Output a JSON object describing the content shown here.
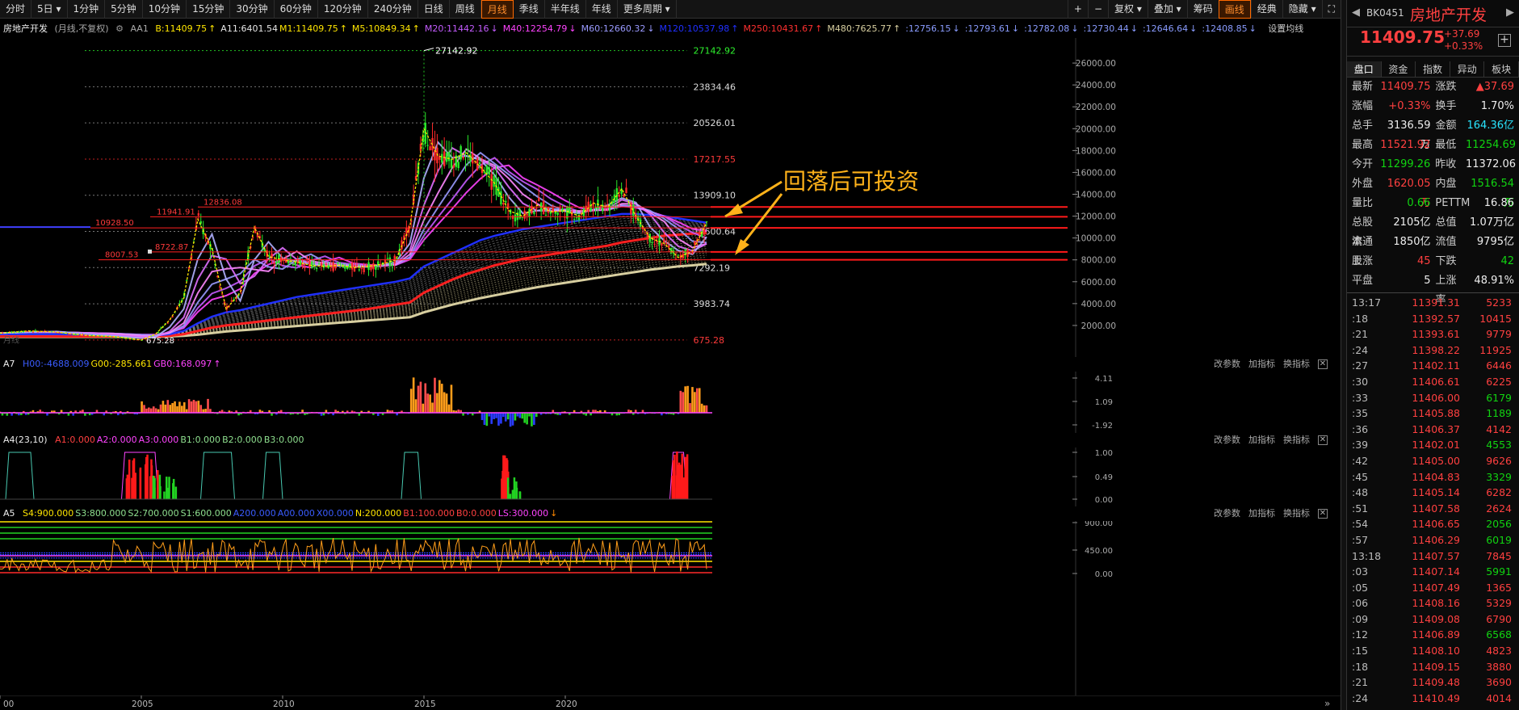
{
  "toolbar": {
    "periods": [
      "分时",
      "5日",
      "1分钟",
      "5分钟",
      "10分钟",
      "15分钟",
      "30分钟",
      "60分钟",
      "120分钟",
      "240分钟",
      "日线",
      "周线",
      "月线",
      "季线",
      "半年线",
      "年线",
      "更多周期"
    ],
    "active_period": "月线",
    "plus": "+",
    "minus": "−",
    "tools": [
      "复权",
      "叠加",
      "筹码",
      "画线",
      "经典",
      "隐藏"
    ],
    "active_tool": "画线"
  },
  "main_info": {
    "title": "房地产开发",
    "mode": "(月线,不复权)",
    "aa1": "AA1",
    "items": [
      {
        "t": "B:11409.75",
        "c": "#ffe600"
      },
      {
        "t": "↑",
        "c": "#ffe600"
      },
      {
        "t": "A11:6401.54",
        "c": "#e7e7e7"
      },
      {
        "t": "M1:11409.75",
        "c": "#ffe600"
      },
      {
        "t": "↑",
        "c": "#ffe600"
      },
      {
        "t": "M5:10849.34",
        "c": "#ffe600"
      },
      {
        "t": "↑",
        "c": "#ffe600"
      },
      {
        "t": "M20:11442.16",
        "c": "#c45cff"
      },
      {
        "t": "↓",
        "c": "#c45cff"
      },
      {
        "t": "M40:12254.79",
        "c": "#ff44ff"
      },
      {
        "t": "↓",
        "c": "#ff44ff"
      },
      {
        "t": "M60:12660.32",
        "c": "#9a9aff"
      },
      {
        "t": "↓",
        "c": "#9a9aff"
      },
      {
        "t": "M120:10537.98",
        "c": "#2030ff"
      },
      {
        "t": "↑",
        "c": "#2030ff"
      },
      {
        "t": "M250:10431.67",
        "c": "#ff3030"
      },
      {
        "t": "↑",
        "c": "#ff3030"
      },
      {
        "t": "M480:7625.77",
        "c": "#d8cfa0"
      },
      {
        "t": "↑",
        "c": "#d8cfa0"
      },
      {
        "t": ":12756.15",
        "c": "#8a9cff"
      },
      {
        "t": "↓",
        "c": "#8a9cff"
      },
      {
        "t": ":12793.61",
        "c": "#8a9cff"
      },
      {
        "t": "↓",
        "c": "#8a9cff"
      },
      {
        "t": ":12782.08",
        "c": "#8a9cff"
      },
      {
        "t": "↓",
        "c": "#8a9cff"
      },
      {
        "t": ":12730.44",
        "c": "#8a9cff"
      },
      {
        "t": "↓",
        "c": "#8a9cff"
      },
      {
        "t": ":12646.64",
        "c": "#8a9cff"
      },
      {
        "t": "↓",
        "c": "#8a9cff"
      },
      {
        "t": ":12408.85",
        "c": "#8a9cff"
      },
      {
        "t": "↓",
        "c": "#8a9cff"
      }
    ],
    "settings": "设置均线"
  },
  "chart_data": {
    "type": "line",
    "x": [
      2000,
      2001,
      2002,
      2003,
      2004,
      2005,
      2005.5,
      2006,
      2006.5,
      2007,
      2007.5,
      2008,
      2008.5,
      2009,
      2009.5,
      2010,
      2010.5,
      2011,
      2011.5,
      2012,
      2012.5,
      2013,
      2013.5,
      2014,
      2014.5,
      2015,
      2015.5,
      2016,
      2016.5,
      2017,
      2017.5,
      2018,
      2018.5,
      2019,
      2019.5,
      2020,
      2020.5,
      2021,
      2021.5,
      2022,
      2022.5,
      2023,
      2023.5,
      2024,
      2024.5,
      2025
    ],
    "close": [
      1300,
      1500,
      1400,
      1100,
      1000,
      675,
      1200,
      2500,
      4500,
      11700,
      9000,
      3500,
      5000,
      11000,
      8300,
      8000,
      7800,
      7500,
      7400,
      7500,
      7300,
      7400,
      7600,
      8000,
      11000,
      20000,
      17500,
      17200,
      17800,
      16500,
      15000,
      12500,
      12000,
      13000,
      12400,
      12500,
      12000,
      13200,
      12800,
      14500,
      12000,
      10000,
      9500,
      8200,
      8800,
      11409.75
    ],
    "high_annotation": {
      "x": 2015,
      "v": 27142.92,
      "label": "27142.92"
    },
    "low_annotation": {
      "x": 2005,
      "v": 675.28,
      "label": "675.28"
    },
    "ma120": [
      1200,
      1200,
      1200,
      1150,
      1100,
      1050,
      1080,
      1200,
      1500,
      2200,
      2800,
      3200,
      3400,
      3700,
      4000,
      4300,
      4600,
      4800,
      5000,
      5200,
      5400,
      5600,
      5800,
      6000,
      6300,
      7400,
      8000,
      8600,
      9200,
      9800,
      10200,
      10500,
      10800,
      11000,
      11200,
      11400,
      11600,
      11800,
      12000,
      12200,
      12200,
      12100,
      12000,
      11800,
      11600,
      11400
    ],
    "ma250": [
      1000,
      1000,
      1000,
      1000,
      1000,
      1000,
      1000,
      1050,
      1200,
      1500,
      1800,
      2000,
      2150,
      2300,
      2450,
      2600,
      2750,
      2900,
      3050,
      3200,
      3350,
      3500,
      3700,
      3900,
      4100,
      5000,
      5600,
      6200,
      6700,
      7100,
      7500,
      7800,
      8100,
      8300,
      8500,
      8700,
      8900,
      9100,
      9300,
      9600,
      9800,
      10000,
      10200,
      10300,
      10400,
      10431.67
    ],
    "ma480": [
      950,
      950,
      950,
      950,
      950,
      950,
      950,
      1000,
      1050,
      1150,
      1300,
      1450,
      1550,
      1650,
      1750,
      1850,
      1950,
      2050,
      2150,
      2250,
      2350,
      2450,
      2550,
      2650,
      2750,
      3200,
      3550,
      3900,
      4200,
      4500,
      4750,
      5000,
      5250,
      5500,
      5700,
      5900,
      6100,
      6300,
      6500,
      6700,
      6900,
      7100,
      7250,
      7400,
      7500,
      7625.77
    ],
    "y_ticks": [
      "26000.00",
      "24000.00",
      "22000.00",
      "20000.00",
      "18000.00",
      "16000.00",
      "14000.00",
      "12000.00",
      "10000.00",
      "8000.00",
      "6000.00",
      "4000.00",
      "2000.00"
    ],
    "x_ticks": [
      "00",
      "2005",
      "2010",
      "2015",
      "2020"
    ],
    "ylim": [
      0,
      28000
    ]
  },
  "price_labels": {
    "fib": [
      "27142.92",
      "23834.46",
      "20526.01",
      "17217.55",
      "13909.10",
      "10600.64",
      "7292.19",
      "3983.74",
      "675.28"
    ],
    "hlines": [
      "12836.08",
      "11941.91",
      "10928.50",
      "8722.87",
      "8007.53"
    ],
    "peak": "27142.92",
    "low": "675.28",
    "bottom_tag": "月线"
  },
  "annotation": {
    "text": "回落后可投资",
    "color": "#ffb21a"
  },
  "panel_a7": {
    "name": "A7",
    "items": [
      {
        "t": "H00:-4688.009",
        "c": "#3a5cff"
      },
      {
        "t": "G00:-285.661",
        "c": "#ffe600"
      },
      {
        "t": "GB0:168.097",
        "c": "#ff44ff"
      },
      {
        "t": "↑",
        "c": "#ff44ff"
      }
    ],
    "y_ticks": [
      "4.11",
      "1.09",
      "-1.92"
    ],
    "tools": [
      "改参数",
      "加指标",
      "换指标"
    ]
  },
  "panel_a4": {
    "name": "A4(23,10)",
    "items": [
      {
        "t": "A1:0.000",
        "c": "#ff4040"
      },
      {
        "t": "A2:0.000",
        "c": "#ff44ff"
      },
      {
        "t": "A3:0.000",
        "c": "#ff44ff"
      },
      {
        "t": "B1:0.000",
        "c": "#8fe08f"
      },
      {
        "t": "B2:0.000",
        "c": "#8fe08f"
      },
      {
        "t": "B3:0.000",
        "c": "#8fe08f"
      }
    ],
    "y_ticks": [
      "1.00",
      "0.49",
      "0.00"
    ],
    "tools": [
      "改参数",
      "加指标",
      "换指标"
    ]
  },
  "panel_a5": {
    "name": "A5",
    "items": [
      {
        "t": "S4:900.000",
        "c": "#ffe600"
      },
      {
        "t": "S3:800.000",
        "c": "#8fe08f"
      },
      {
        "t": "S2:700.000",
        "c": "#8fe08f"
      },
      {
        "t": "S1:600.000",
        "c": "#8fe08f"
      },
      {
        "t": "A200.000",
        "c": "#3a5cff"
      },
      {
        "t": "A00.000",
        "c": "#3a5cff"
      },
      {
        "t": "X00.000",
        "c": "#3a5cff"
      },
      {
        "t": "N:200.000",
        "c": "#ffe600"
      },
      {
        "t": "B1:100.000",
        "c": "#ff4040"
      },
      {
        "t": "B0:0.000",
        "c": "#ff4040"
      },
      {
        "t": "LS:300.000",
        "c": "#ff44ff"
      },
      {
        "t": "↓",
        "c": "#ff8800"
      }
    ],
    "y_ticks": [
      "900.00",
      "450.00",
      "0.00"
    ],
    "tools": [
      "改参数",
      "加指标",
      "换指标"
    ]
  },
  "sidebar": {
    "code": "BK0451",
    "name": "房地产开发",
    "price": "11409.75",
    "change": "+37.69",
    "change_pct": "+0.33%",
    "tabs": [
      "盘口",
      "资金",
      "指数",
      "异动",
      "板块"
    ],
    "stats": [
      {
        "l1": "最新",
        "v1": "11409.75",
        "c1": "red",
        "l2": "涨跌",
        "v2": "▲37.69",
        "c2": "red"
      },
      {
        "l1": "涨幅",
        "v1": "+0.33%",
        "c1": "red",
        "l2": "换手",
        "v2": "1.70%",
        "c2": "white"
      },
      {
        "l1": "总手",
        "v1": "3136.59万",
        "c1": "white",
        "l2": "金额",
        "v2": "164.36亿",
        "c2": "cyan"
      },
      {
        "l1": "最高",
        "v1": "11521.92",
        "c1": "red",
        "l2": "最低",
        "v2": "11254.69",
        "c2": "green"
      },
      {
        "l1": "今开",
        "v1": "11299.26",
        "c1": "green",
        "l2": "昨收",
        "v2": "11372.06",
        "c2": "white"
      },
      {
        "l1": "外盘",
        "v1": "1620.05万",
        "c1": "red",
        "l2": "内盘",
        "v2": "1516.54万",
        "c2": "green"
      },
      {
        "l1": "量比",
        "v1": "0.66",
        "c1": "green",
        "l2": "PETTM",
        "v2": "16.86",
        "c2": "white"
      },
      {
        "l1": "总股本",
        "v1": "2105亿",
        "c1": "white",
        "l2": "总值",
        "v2": "1.07万亿",
        "c2": "white"
      },
      {
        "l1": "流通股",
        "v1": "1850亿",
        "c1": "white",
        "l2": "流值",
        "v2": "9795亿",
        "c2": "white"
      },
      {
        "l1": "上涨",
        "v1": "45",
        "c1": "red",
        "l2": "下跌",
        "v2": "42",
        "c2": "green"
      },
      {
        "l1": "平盘",
        "v1": "5",
        "c1": "white",
        "l2": "上涨率",
        "v2": "48.91%",
        "c2": "white"
      }
    ],
    "ticks": [
      {
        "t": "13:17",
        "p": "11391.31",
        "v": "5233",
        "vc": "red"
      },
      {
        "t": ":18",
        "p": "11392.57",
        "v": "10415",
        "vc": "red"
      },
      {
        "t": ":21",
        "p": "11393.61",
        "v": "9779",
        "vc": "red"
      },
      {
        "t": ":24",
        "p": "11398.22",
        "v": "11925",
        "vc": "red"
      },
      {
        "t": ":27",
        "p": "11402.11",
        "v": "6446",
        "vc": "red"
      },
      {
        "t": ":30",
        "p": "11406.61",
        "v": "6225",
        "vc": "red"
      },
      {
        "t": ":33",
        "p": "11406.00",
        "v": "6179",
        "vc": "green"
      },
      {
        "t": ":35",
        "p": "11405.88",
        "v": "1189",
        "vc": "green"
      },
      {
        "t": ":36",
        "p": "11406.37",
        "v": "4142",
        "vc": "red"
      },
      {
        "t": ":39",
        "p": "11402.01",
        "v": "4553",
        "vc": "green"
      },
      {
        "t": ":42",
        "p": "11405.00",
        "v": "9626",
        "vc": "red"
      },
      {
        "t": ":45",
        "p": "11404.83",
        "v": "3329",
        "vc": "green"
      },
      {
        "t": ":48",
        "p": "11405.14",
        "v": "6282",
        "vc": "red"
      },
      {
        "t": ":51",
        "p": "11407.58",
        "v": "2624",
        "vc": "red"
      },
      {
        "t": ":54",
        "p": "11406.65",
        "v": "2056",
        "vc": "green"
      },
      {
        "t": ":57",
        "p": "11406.29",
        "v": "6019",
        "vc": "green"
      },
      {
        "t": "13:18",
        "p": "11407.57",
        "v": "7845",
        "vc": "red"
      },
      {
        "t": ":03",
        "p": "11407.14",
        "v": "5991",
        "vc": "green"
      },
      {
        "t": ":05",
        "p": "11407.49",
        "v": "1365",
        "vc": "red"
      },
      {
        "t": ":06",
        "p": "11408.16",
        "v": "5329",
        "vc": "red"
      },
      {
        "t": ":09",
        "p": "11409.08",
        "v": "6790",
        "vc": "red"
      },
      {
        "t": ":12",
        "p": "11406.89",
        "v": "6568",
        "vc": "green"
      },
      {
        "t": ":15",
        "p": "11408.10",
        "v": "4823",
        "vc": "red"
      },
      {
        "t": ":18",
        "p": "11409.15",
        "v": "3880",
        "vc": "red"
      },
      {
        "t": ":21",
        "p": "11409.48",
        "v": "3690",
        "vc": "red"
      },
      {
        "t": ":24",
        "p": "11410.49",
        "v": "4014",
        "vc": "red"
      }
    ]
  }
}
